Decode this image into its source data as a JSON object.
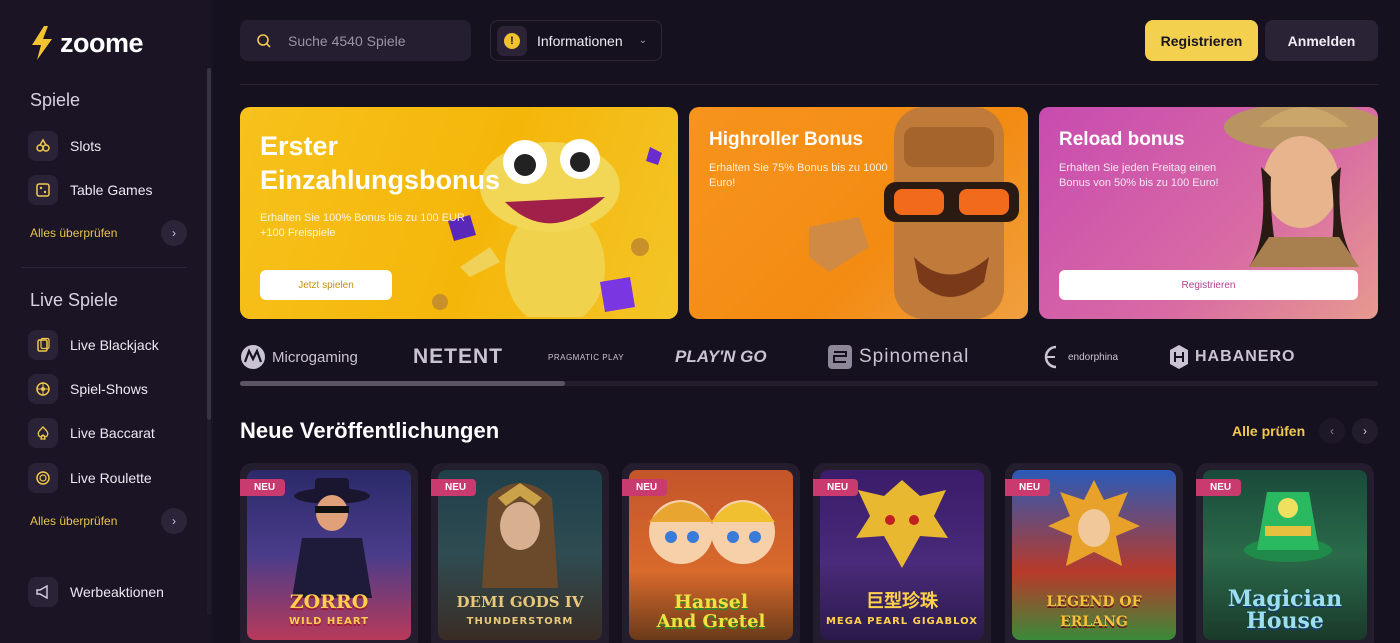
{
  "brand": {
    "name": "zoome",
    "accent": "#f4d04f"
  },
  "sidebar": {
    "sections": [
      {
        "title": "Spiele",
        "items": [
          {
            "label": "Slots",
            "icon": "slot-machine-icon"
          },
          {
            "label": "Table Games",
            "icon": "dice-icon"
          }
        ],
        "more_label": "Alles überprüfen"
      },
      {
        "title": "Live Spiele",
        "items": [
          {
            "label": "Live Blackjack",
            "icon": "cards-icon"
          },
          {
            "label": "Spiel-Shows",
            "icon": "wheel-icon"
          },
          {
            "label": "Live Baccarat",
            "icon": "spade-icon"
          },
          {
            "label": "Live Roulette",
            "icon": "roulette-icon"
          }
        ],
        "more_label": "Alles überprüfen"
      }
    ],
    "promotions": {
      "label": "Werbeaktionen",
      "icon": "megaphone-icon"
    }
  },
  "header": {
    "search_placeholder": "Suche 4540 Spiele",
    "info_label": "Informationen",
    "info_badge": "!",
    "register_label": "Registrieren",
    "login_label": "Anmelden"
  },
  "promos": [
    {
      "title_line1": "Erster",
      "title_line2": "Einzahlungsbonus",
      "desc_line1": "Erhalten Sie 100% Bonus bis zu 100 EUR",
      "desc_line2": "+100 Freispiele",
      "button": "Jetzt spielen"
    },
    {
      "title": "Highroller Bonus",
      "desc_line1": "Erhalten Sie 75% Bonus bis zu 1000",
      "desc_line2": "Euro!"
    },
    {
      "title": "Reload bonus",
      "desc_line1": "Erhalten Sie jeden Freitag einen",
      "desc_line2": "Bonus von 50% bis zu 100 Euro!",
      "button": "Registrieren"
    }
  ],
  "providers": [
    "Microgaming",
    "NETENT",
    "PRAGMATIC PLAY",
    "PLAY'N GO",
    "Spinomenal",
    "endorphina",
    "HABANERO"
  ],
  "new_releases": {
    "title": "Neue Veröffentlichungen",
    "see_all": "Alle prüfen",
    "badge": "NEU",
    "games": [
      {
        "name": "ZORRO",
        "sub": "WILD HEART"
      },
      {
        "name": "DEMI GODS IV",
        "sub": "THUNDERSTORM"
      },
      {
        "name": "Hansel",
        "sub": "And Gretel"
      },
      {
        "name": "巨型珍珠",
        "sub": "MEGA PEARL GIGABLOX"
      },
      {
        "name": "LEGEND OF ERLANG",
        "sub": ""
      },
      {
        "name": "Magician",
        "sub": "House"
      }
    ]
  }
}
